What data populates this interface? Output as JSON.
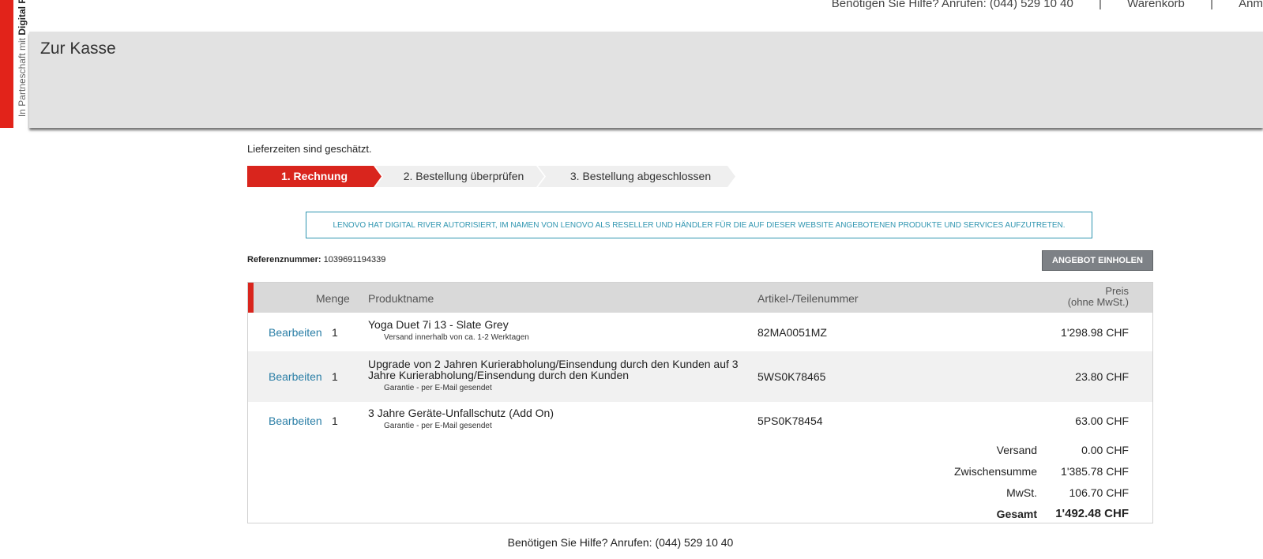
{
  "brand": {
    "partner_text": "In Partneschaft mit",
    "partner_name": "Digital R"
  },
  "topnav": {
    "help": "Benötigen Sie Hilfe? Anrufen: (044) 529 10 40",
    "sep": "|",
    "cart": "Warenkorb",
    "account": "Anm"
  },
  "header": {
    "title": "Zur Kasse"
  },
  "delivery_note": "Lieferzeiten sind geschätzt.",
  "steps": [
    {
      "label": "1. Rechnung"
    },
    {
      "label": "2. Bestellung überprüfen"
    },
    {
      "label": "3. Bestellung abgeschlossen"
    }
  ],
  "notice": "LENOVO HAT DIGITAL RIVER AUTORISIERT, IM NAMEN VON LENOVO ALS RESELLER UND HÄNDLER FÜR DIE AUF DIESER WEBSITE ANGEBOTENEN PRODUKTE UND SERVICES AUFZUTRETEN.",
  "reference": {
    "label": "Referenznummer:",
    "value": "1039691194339"
  },
  "quote_button": "ANGEBOT EINHOLEN",
  "table": {
    "headers": {
      "qty": "Menge",
      "product": "Produktname",
      "part": "Artikel-/Teilenummer",
      "price_line1": "Preis",
      "price_line2": "(ohne MwSt.)"
    },
    "rows": [
      {
        "edit": "Bearbeiten",
        "qty": "1",
        "name": "Yoga Duet 7i 13 - Slate Grey",
        "note": "Versand innerhalb von ca. 1-2 Werktagen",
        "part": "82MA0051MZ",
        "price": "1'298.98 CHF"
      },
      {
        "edit": "Bearbeiten",
        "qty": "1",
        "name": "Upgrade von 2 Jahren Kurierabholung/Einsendung durch den Kunden auf 3 Jahre Kurierabholung/Einsendung durch den Kunden",
        "note": "Garantie - per E-Mail gesendet",
        "part": "5WS0K78465",
        "price": "23.80 CHF"
      },
      {
        "edit": "Bearbeiten",
        "qty": "1",
        "name": "3 Jahre Geräte-Unfallschutz (Add On)",
        "note": "Garantie - per E-Mail gesendet",
        "part": "5PS0K78454",
        "price": "63.00 CHF"
      }
    ],
    "summary": [
      {
        "label": "Versand",
        "value": "0.00 CHF"
      },
      {
        "label": "Zwischensumme",
        "value": "1'385.78 CHF"
      },
      {
        "label": "MwSt.",
        "value": "106.70 CHF"
      },
      {
        "label": "Gesamt",
        "value": "1'492.48 CHF"
      }
    ]
  },
  "footer_help": "Benötigen Sie Hilfe? Anrufen: (044) 529 10 40",
  "colors": {
    "accent": "#d9251d",
    "link": "#2a7ea6",
    "notice": "#2f95b0"
  }
}
